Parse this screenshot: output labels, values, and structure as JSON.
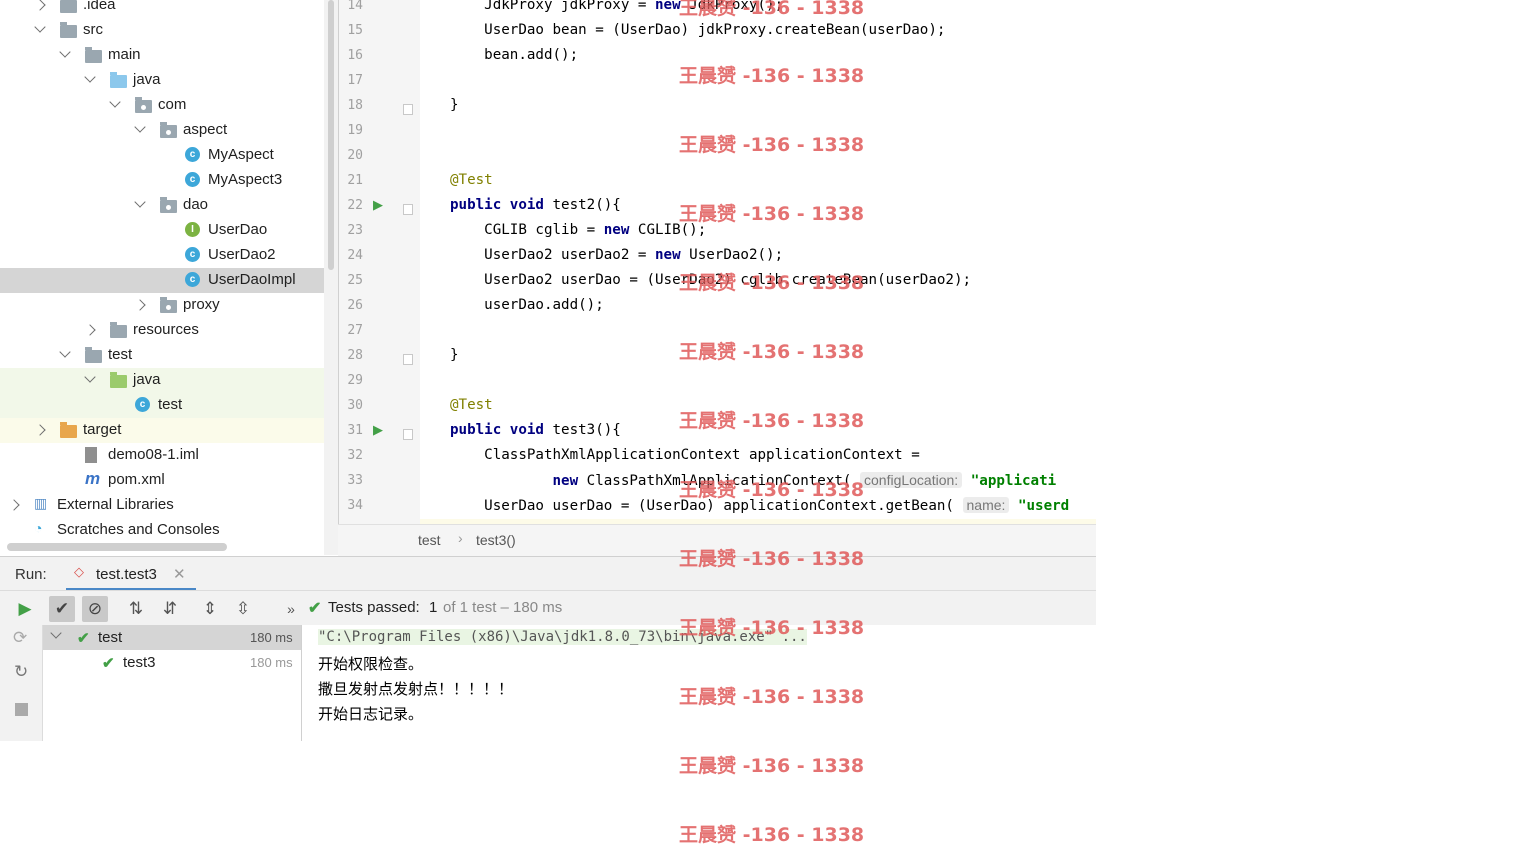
{
  "project_tree": [
    {
      "label": ".idea",
      "indent": 0,
      "arrow": "right",
      "icon": "folder-icon"
    },
    {
      "label": "src",
      "indent": 0,
      "arrow": "down",
      "icon": "folder-icon"
    },
    {
      "label": "main",
      "indent": 1,
      "arrow": "down",
      "icon": "folder-icon"
    },
    {
      "label": "java",
      "indent": 2,
      "arrow": "down",
      "icon": "source-folder-icon"
    },
    {
      "label": "com",
      "indent": 3,
      "arrow": "down",
      "icon": "package-icon"
    },
    {
      "label": "aspect",
      "indent": 4,
      "arrow": "down",
      "icon": "package-icon"
    },
    {
      "label": "MyAspect",
      "indent": 5,
      "arrow": "",
      "icon": "class-icon"
    },
    {
      "label": "MyAspect3",
      "indent": 5,
      "arrow": "",
      "icon": "class-icon"
    },
    {
      "label": "dao",
      "indent": 4,
      "arrow": "down",
      "icon": "package-icon"
    },
    {
      "label": "UserDao",
      "indent": 5,
      "arrow": "",
      "icon": "interface-icon"
    },
    {
      "label": "UserDao2",
      "indent": 5,
      "arrow": "",
      "icon": "class-icon"
    },
    {
      "label": "UserDaoImpl",
      "indent": 5,
      "arrow": "",
      "icon": "class-icon",
      "selected": true
    },
    {
      "label": "proxy",
      "indent": 4,
      "arrow": "right",
      "icon": "package-icon"
    },
    {
      "label": "resources",
      "indent": 2,
      "arrow": "right",
      "icon": "resources-folder-icon"
    },
    {
      "label": "test",
      "indent": 1,
      "arrow": "down",
      "icon": "folder-icon"
    },
    {
      "label": "java",
      "indent": 2,
      "arrow": "down",
      "icon": "test-folder-icon",
      "green": true
    },
    {
      "label": "test",
      "indent": 3,
      "arrow": "",
      "icon": "test-class-icon",
      "green": true
    },
    {
      "label": "target",
      "indent": 0,
      "arrow": "right",
      "icon": "excluded-folder-icon",
      "yellow": true
    },
    {
      "label": "demo08-1.iml",
      "indent": 1,
      "arrow": "",
      "icon": "iml-file-icon"
    },
    {
      "label": "pom.xml",
      "indent": 1,
      "arrow": "",
      "icon": "maven-icon"
    },
    {
      "label": "External Libraries",
      "indent": -1,
      "arrow": "right",
      "icon": "libraries-icon"
    },
    {
      "label": "Scratches and Consoles",
      "indent": -1,
      "arrow": "",
      "icon": "scratches-icon"
    }
  ],
  "editor": {
    "line_numbers": [
      "14",
      "15",
      "16",
      "17",
      "18",
      "19",
      "20",
      "21",
      "22",
      "23",
      "24",
      "25",
      "26",
      "27",
      "28",
      "29",
      "30",
      "31",
      "32",
      "33",
      "34"
    ],
    "lines": [
      [
        {
          "t": "    JdkProxy jdkProxy = "
        },
        {
          "t": "new",
          "c": "kw"
        },
        {
          "t": " JdkProxy();"
        }
      ],
      [
        {
          "t": "    UserDao bean = (UserDao) jdkProxy.createBean(userDao);"
        }
      ],
      [
        {
          "t": "    bean.add();"
        }
      ],
      [
        {
          "t": ""
        }
      ],
      [
        {
          "t": "}"
        }
      ],
      [
        {
          "t": ""
        }
      ],
      [
        {
          "t": ""
        }
      ],
      [
        {
          "t": "@Test",
          "c": "ann"
        }
      ],
      [
        {
          "t": "public",
          "c": "kw"
        },
        {
          "t": " "
        },
        {
          "t": "void",
          "c": "kw"
        },
        {
          "t": " test2(){"
        }
      ],
      [
        {
          "t": "    CGLIB cglib = "
        },
        {
          "t": "new",
          "c": "kw"
        },
        {
          "t": " CGLIB();"
        }
      ],
      [
        {
          "t": "    UserDao2 userDao2 = "
        },
        {
          "t": "new",
          "c": "kw"
        },
        {
          "t": " UserDao2();"
        }
      ],
      [
        {
          "t": "    UserDao2 userDao = (UserDao2) cglib.createBean(userDao2);"
        }
      ],
      [
        {
          "t": "    userDao.add();"
        }
      ],
      [
        {
          "t": ""
        }
      ],
      [
        {
          "t": "}"
        }
      ],
      [
        {
          "t": ""
        }
      ],
      [
        {
          "t": "@Test",
          "c": "ann"
        }
      ],
      [
        {
          "t": "public",
          "c": "kw"
        },
        {
          "t": " "
        },
        {
          "t": "void",
          "c": "kw"
        },
        {
          "t": " test3(){"
        }
      ],
      [
        {
          "t": "    ClassPathXmlApplicationContext applicationContext ="
        }
      ],
      [
        {
          "t": "            "
        },
        {
          "t": "new",
          "c": "kw"
        },
        {
          "t": " ClassPathXmlApplicationContext( "
        },
        {
          "t": "configLocation:",
          "c": "hint"
        },
        {
          "t": " "
        },
        {
          "t": "\"applicati",
          "c": "str"
        }
      ],
      [
        {
          "t": "    UserDao userDao = (UserDao) applicationContext.getBean( "
        },
        {
          "t": "name:",
          "c": "hint"
        },
        {
          "t": " "
        },
        {
          "t": "\"userd",
          "c": "str"
        }
      ]
    ],
    "breadcrumb": [
      "test",
      "test3()"
    ]
  },
  "run": {
    "title": "Run:",
    "tab": "test.test3",
    "status_prefix": "Tests passed:",
    "status_count": "1",
    "status_rest": "of 1 test – 180 ms",
    "tests": [
      {
        "name": "test",
        "time": "180 ms"
      },
      {
        "name": "test3",
        "time": "180 ms"
      }
    ],
    "console": [
      "\"C:\\Program Files (x86)\\Java\\jdk1.8.0_73\\bin\\java.exe\" ...",
      "开始权限检查。",
      "撒旦发射点发射点！！！！！",
      "开始日志记录。"
    ]
  },
  "watermark": "王晨赟 -136 - 1338"
}
